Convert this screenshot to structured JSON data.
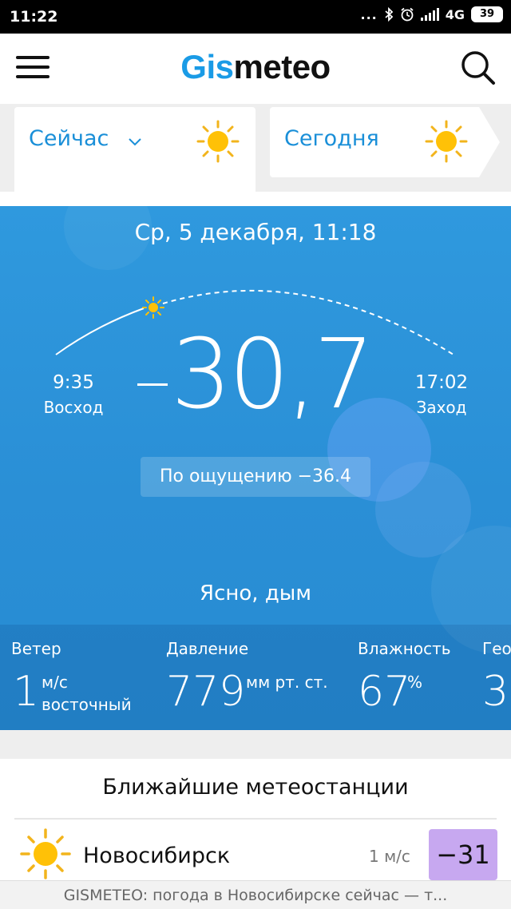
{
  "status_bar": {
    "time": "11:22",
    "dots": "...",
    "network": "4G",
    "battery": "39",
    "icons": [
      "more-dots-icon",
      "bluetooth-icon",
      "alarm-icon",
      "signal-icon",
      "battery-icon"
    ]
  },
  "header": {
    "logo_part1": "Gis",
    "logo_part2": "meteo",
    "logo_color": "#1a9be6",
    "menu_icon": "hamburger-menu-icon",
    "search_icon": "search-icon"
  },
  "tabs": [
    {
      "label": "Сейчас",
      "icon": "sun-icon",
      "has_dropdown": true,
      "active": true
    },
    {
      "label": "Сегодня",
      "icon": "sun-icon",
      "has_dropdown": false,
      "active": false
    }
  ],
  "weather": {
    "date": "Ср, 5 декабря, 11:18",
    "sunrise_time": "9:35",
    "sunrise_label": "Восход",
    "sunset_time": "17:02",
    "sunset_label": "Заход",
    "temperature": "30,7",
    "feels_like": "По ощущению −36.4",
    "condition": "Ясно, дым",
    "panel_color": "#2a8fd6"
  },
  "params": {
    "wind_title": "Ветер",
    "wind_value": "1",
    "wind_unit": "м/с",
    "wind_dir": "восточный",
    "pressure_title": "Давление",
    "pressure_value": "779",
    "pressure_unit": "мм рт. ст.",
    "humidity_title": "Влажность",
    "humidity_value": "67",
    "humidity_unit": "%",
    "geo_title": "Гео",
    "geo_value": "3"
  },
  "stations": {
    "title": "Ближайшие метеостанции",
    "items": [
      {
        "name": "Новосибирск",
        "wind": "1 м/с",
        "temp": "−31",
        "temp_color": "#c7a8f0",
        "icon": "sun-icon"
      }
    ]
  },
  "url_bar": {
    "text": "GISMETEO: погода в Новосибирске сейчас — т..."
  }
}
